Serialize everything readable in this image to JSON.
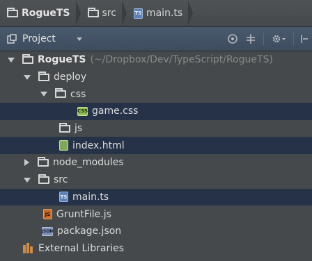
{
  "breadcrumb": [
    {
      "label": "RogueTS",
      "icon": "folder-icon",
      "bold": true
    },
    {
      "label": "src",
      "icon": "folder-icon",
      "bold": false
    },
    {
      "label": "main.ts",
      "icon": "typescript-file-icon",
      "bold": false
    }
  ],
  "toolbar": {
    "view_label": "Project",
    "icons": [
      "target-icon",
      "collapse-icon",
      "gear-icon",
      "hide-icon"
    ]
  },
  "tree": {
    "root": {
      "name": "RogueTS",
      "path": "(~/Dropbox/Dev/TypeScript/RogueTS)"
    },
    "deploy": "deploy",
    "css": "css",
    "game_css": "game.css",
    "js": "js",
    "index_html": "index.html",
    "node_modules": "node_modules",
    "src": "src",
    "main_ts": "main.ts",
    "gruntfile": "GruntFile.js",
    "package_json": "package.json",
    "external_libraries": "External Libraries"
  },
  "icon_text": {
    "ts": "TS",
    "css": "CSS",
    "js": "JS",
    "json": "JSON"
  },
  "colors": {
    "background": "#45494b",
    "selection": "#263248",
    "toolbar": "#3d4c5e"
  }
}
